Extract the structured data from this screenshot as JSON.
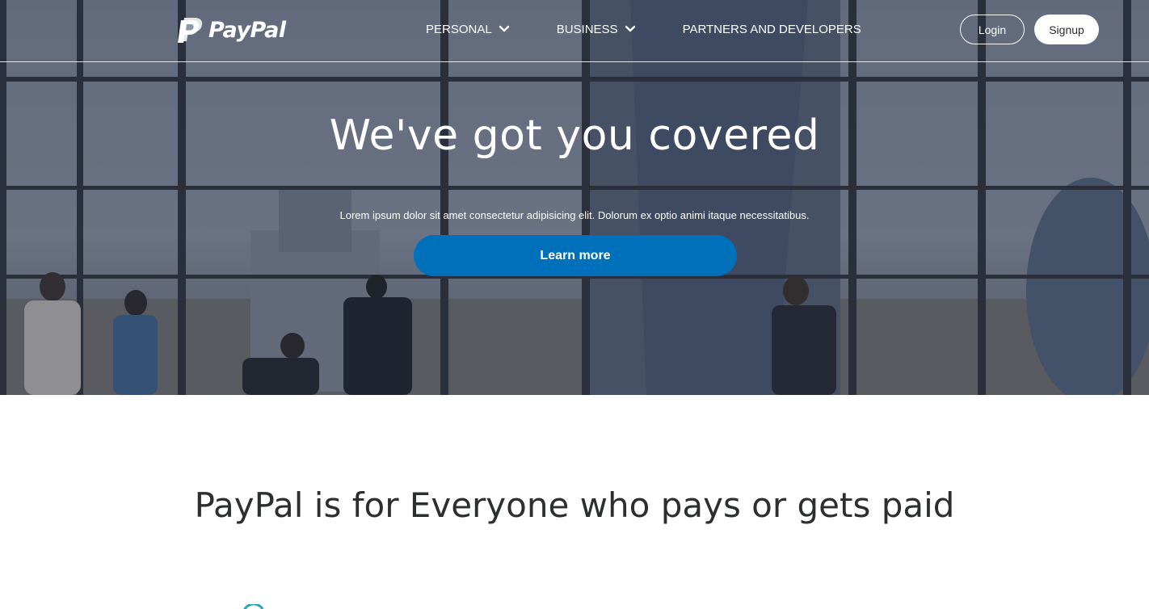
{
  "brand": {
    "name": "PayPal"
  },
  "nav": {
    "links": [
      {
        "label": "PERSONAL",
        "icon": "chevron-down-icon"
      },
      {
        "label": "BUSINESS",
        "icon": "chevron-down-icon"
      },
      {
        "label": "PARTNERS AND DEVELOPERS"
      }
    ],
    "login_label": "Login",
    "signup_label": "Signup"
  },
  "hero": {
    "title": "We've got you covered",
    "subtitle": "Lorem ipsum dolor sit amet consectetur adipisicing elit. Dolorum ex optio animi itaque necessitatibus.",
    "cta_label": "Learn more"
  },
  "section": {
    "title": "PayPal is for Everyone who pays or gets paid"
  },
  "colors": {
    "accent": "#0070ba",
    "text_dark": "#2c2e2f",
    "teal": "#2aa6b5"
  }
}
